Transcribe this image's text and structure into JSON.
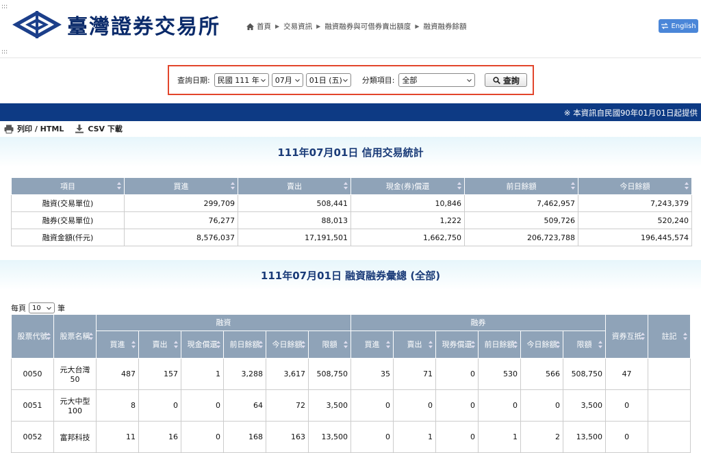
{
  "header": {
    "logo_text": "臺灣證券交易所",
    "breadcrumb": [
      "首頁",
      "交易資訊",
      "融資融券與可借券賣出額度",
      "融資融券餘額"
    ],
    "lang_button": "English"
  },
  "query": {
    "date_label": "查詢日期:",
    "year": "民國 111 年",
    "month": "07月",
    "day": "01日 (五)",
    "category_label": "分類項目:",
    "category": "全部",
    "search_button": "查詢"
  },
  "notice": "※ 本資訊自民國90年01月01日起提供",
  "toolbar": {
    "print": "列印 / HTML",
    "csv": "CSV 下載"
  },
  "credit_section": {
    "title": "111年07月01日 信用交易統計",
    "headers": [
      "項目",
      "買進",
      "賣出",
      "現金(券)償還",
      "前日餘額",
      "今日餘額"
    ],
    "rows": [
      [
        "融資(交易單位)",
        "299,709",
        "508,441",
        "10,846",
        "7,462,957",
        "7,243,379"
      ],
      [
        "融券(交易單位)",
        "76,277",
        "88,013",
        "1,222",
        "509,726",
        "520,240"
      ],
      [
        "融資金額(仟元)",
        "8,576,037",
        "17,191,501",
        "1,662,750",
        "206,723,788",
        "196,445,574"
      ]
    ]
  },
  "summary_section": {
    "title": "111年07月01日 融資融券彙總 (全部)",
    "per_page_prefix": "每頁",
    "per_page_value": "10",
    "per_page_suffix": "筆",
    "group_margin": "融資",
    "group_short": "融券",
    "col_code": "股票代號",
    "col_name": "股票名稱",
    "sub_margin": [
      "買進",
      "賣出",
      "現金償還",
      "前日餘額",
      "今日餘額",
      "限額"
    ],
    "sub_short": [
      "買進",
      "賣出",
      "現券償還",
      "前日餘額",
      "今日餘額",
      "限額"
    ],
    "col_offset": "資券互抵",
    "col_note": "註記",
    "rows": [
      [
        "0050",
        "元大台灣50",
        "487",
        "157",
        "1",
        "3,288",
        "3,617",
        "508,750",
        "35",
        "71",
        "0",
        "530",
        "566",
        "508,750",
        "47",
        ""
      ],
      [
        "0051",
        "元大中型100",
        "8",
        "0",
        "0",
        "64",
        "72",
        "3,500",
        "0",
        "0",
        "0",
        "0",
        "0",
        "3,500",
        "0",
        ""
      ],
      [
        "0052",
        "富邦科技",
        "11",
        "16",
        "0",
        "168",
        "163",
        "13,500",
        "0",
        "1",
        "0",
        "1",
        "2",
        "13,500",
        "0",
        ""
      ]
    ]
  }
}
